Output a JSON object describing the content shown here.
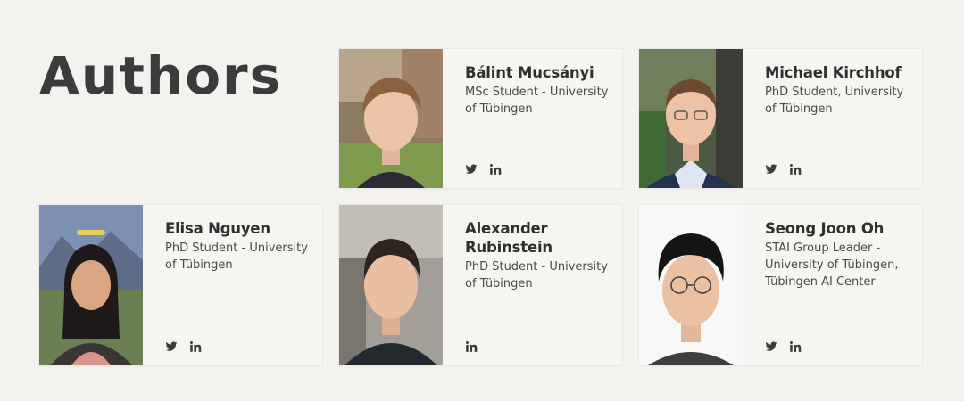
{
  "heading": "Authors",
  "authors": [
    {
      "name": "Bálint Mucsányi",
      "role": "MSc Student - University of Tübingen"
    },
    {
      "name": "Michael Kirchhof",
      "role": "PhD Student, University of Tübingen"
    },
    {
      "name": "Elisa Nguyen",
      "role": "PhD Student - University of Tübingen"
    },
    {
      "name": "Alexander Rubinstein",
      "role": "PhD Student - University of Tübingen"
    },
    {
      "name": "Seong Joon Oh",
      "role": "STAI Group Leader - University of Tübingen, Tübingen AI Center"
    }
  ],
  "icons": {
    "twitter": "twitter-icon",
    "linkedin": "linkedin-icon"
  },
  "colors": {
    "background": "#f3f2ef",
    "card": "#f6f5f2",
    "text": "#3b3b3b"
  }
}
